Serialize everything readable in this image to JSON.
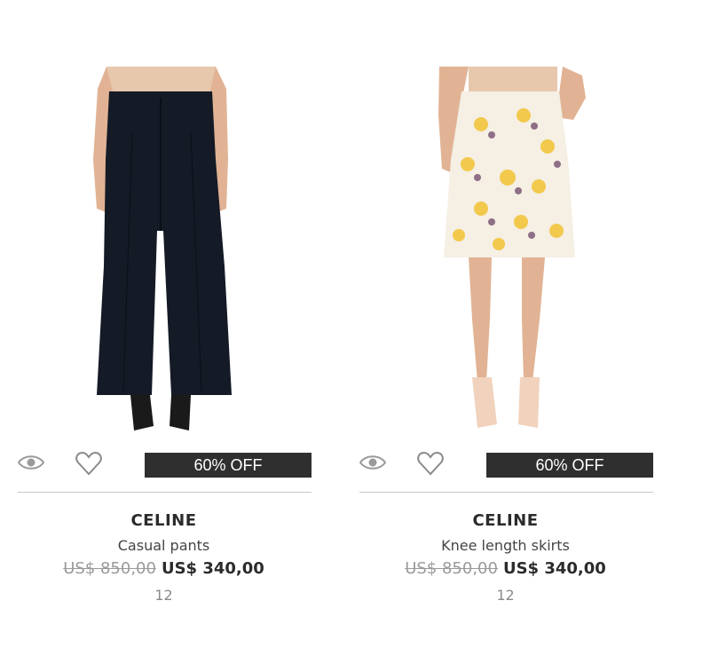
{
  "products": [
    {
      "badge": "60% OFF",
      "brand": "CELINE",
      "type": "Casual pants",
      "old_price": "US$ 850,00",
      "new_price": "US$ 340,00",
      "count": "12",
      "image": "black-wide-leg-pants-photo"
    },
    {
      "badge": "60% OFF",
      "brand": "CELINE",
      "type": "Knee length skirts",
      "old_price": "US$ 850,00",
      "new_price": "US$ 340,00",
      "count": "12",
      "image": "floral-print-skirt-photo"
    }
  ],
  "icons": {
    "view": "eye-icon",
    "wishlist": "heart-icon"
  },
  "colors": {
    "badge_bg": "#2f2f2f",
    "divider": "#c9c9c9",
    "old_price": "#9a9a9a"
  }
}
